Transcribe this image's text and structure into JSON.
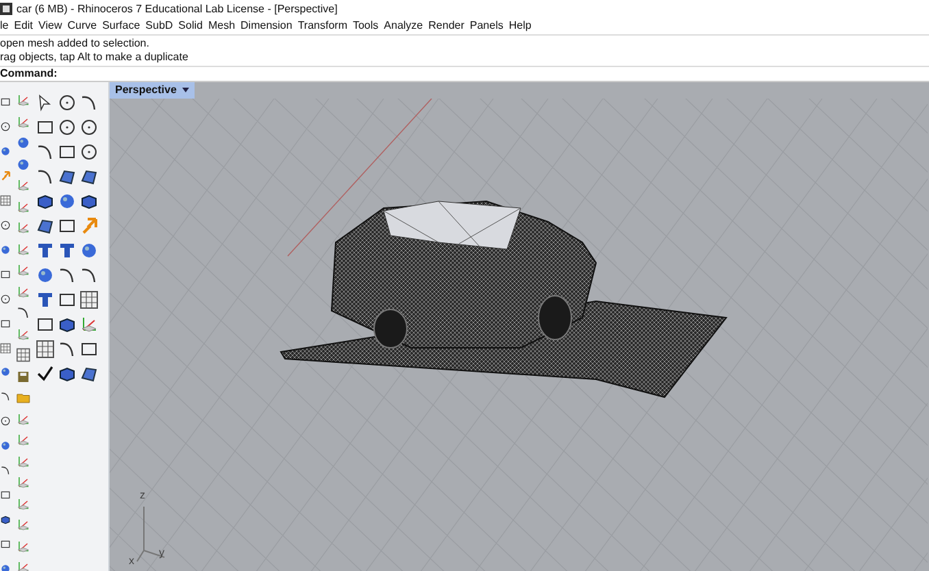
{
  "window": {
    "title": "car (6 MB) - Rhinoceros 7 Educational Lab License - [Perspective]"
  },
  "menu": [
    "le",
    "Edit",
    "View",
    "Curve",
    "Surface",
    "SubD",
    "Solid",
    "Mesh",
    "Dimension",
    "Transform",
    "Tools",
    "Analyze",
    "Render",
    "Panels",
    "Help"
  ],
  "command_history": [
    "open mesh added to selection.",
    "rag objects, tap Alt to make a duplicate"
  ],
  "command_prompt": {
    "label": "Command:"
  },
  "viewport": {
    "tab": "Perspective",
    "axes": [
      "z",
      "x",
      "y"
    ]
  }
}
